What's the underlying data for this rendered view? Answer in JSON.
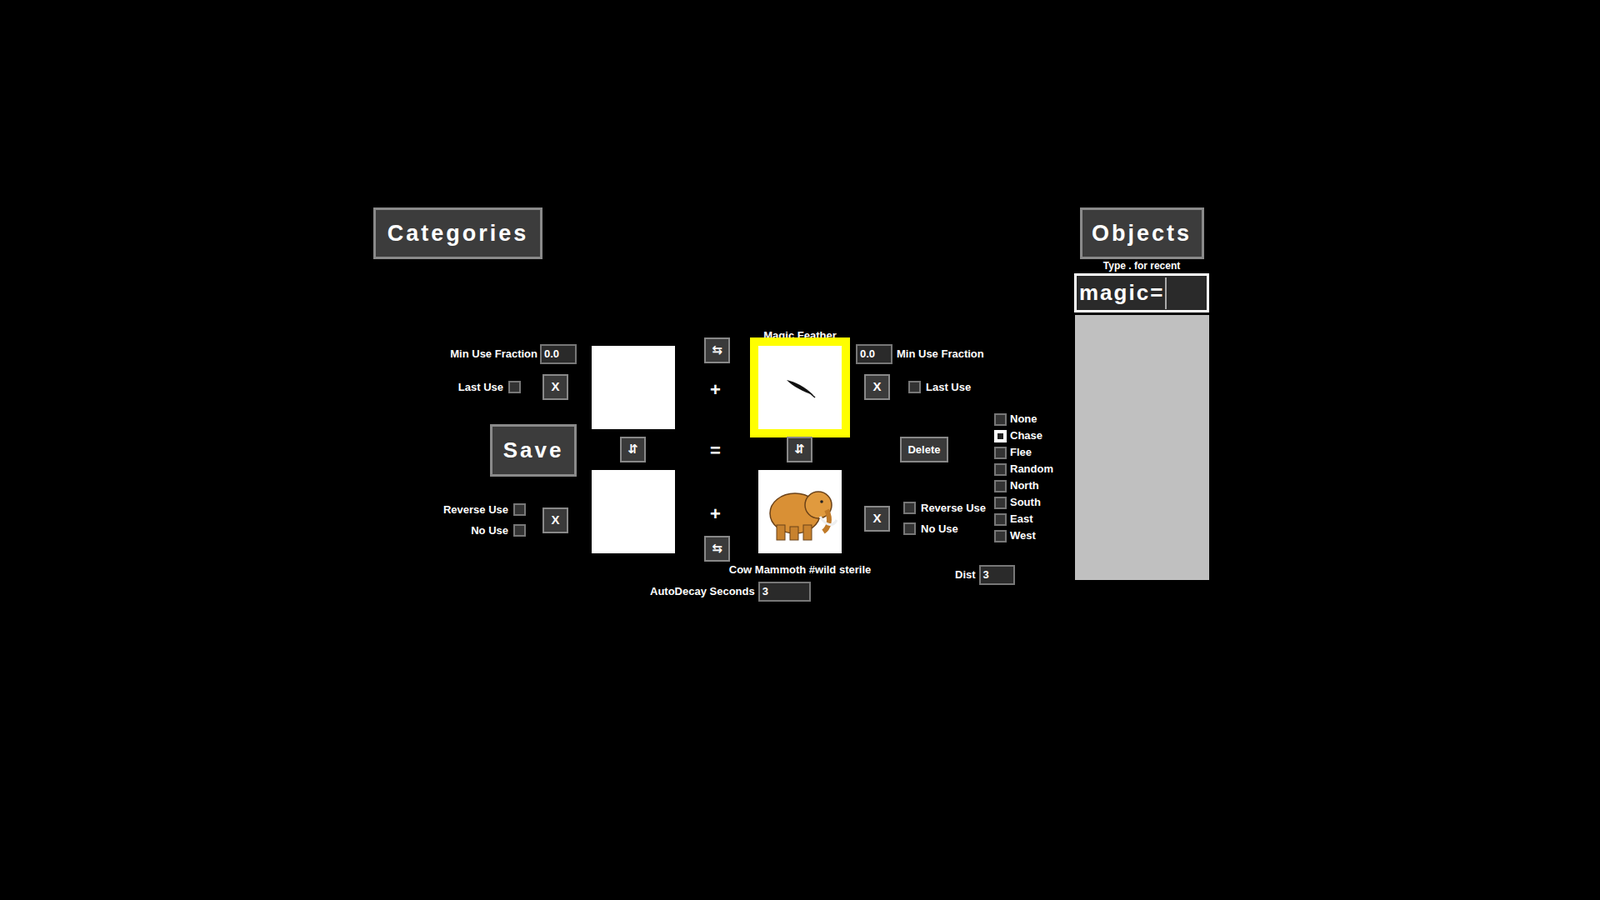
{
  "buttons": {
    "categories": "Categories",
    "objects": "Objects",
    "save": "Save",
    "delete": "Delete",
    "clear": "X"
  },
  "search": {
    "hint": "Type . for recent",
    "value": "magic="
  },
  "glyphs": {
    "swap": "⇆",
    "flip": "⇵",
    "plus": "+",
    "equals": "="
  },
  "left": {
    "min_use_fraction_label": "Min Use Fraction",
    "min_use_fraction": "0.0",
    "last_use_label": "Last Use",
    "last_use": false,
    "reverse_use_label": "Reverse Use",
    "reverse_use": false,
    "no_use_label": "No Use",
    "no_use": false
  },
  "right": {
    "min_use_fraction_label": "Min Use Fraction",
    "min_use_fraction": "0.0",
    "last_use_label": "Last Use",
    "last_use": false,
    "reverse_use_label": "Reverse Use",
    "reverse_use": false,
    "no_use_label": "No Use",
    "no_use": false
  },
  "slots": {
    "actor": {
      "label": "",
      "selected": false,
      "kind": "empty"
    },
    "target": {
      "label": "Magic Feather",
      "selected": true,
      "kind": "feather"
    },
    "new_actor": {
      "label": "",
      "selected": false,
      "kind": "empty"
    },
    "new_target": {
      "label": "Cow Mammoth #wild sterile",
      "selected": false,
      "kind": "mammoth"
    }
  },
  "movement": [
    {
      "label": "None",
      "selected": false
    },
    {
      "label": "Chase",
      "selected": true
    },
    {
      "label": "Flee",
      "selected": false
    },
    {
      "label": "Random",
      "selected": false
    },
    {
      "label": "North",
      "selected": false
    },
    {
      "label": "South",
      "selected": false
    },
    {
      "label": "East",
      "selected": false
    },
    {
      "label": "West",
      "selected": false
    }
  ],
  "dist": {
    "label": "Dist",
    "value": "3"
  },
  "autodecay": {
    "label": "AutoDecay Seconds",
    "value": "3"
  }
}
